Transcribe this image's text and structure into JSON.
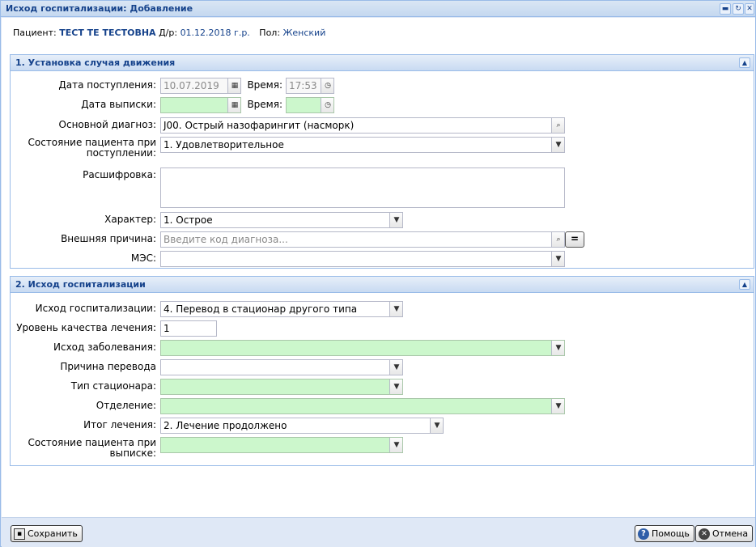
{
  "window": {
    "title": "Исход госпитализации: Добавление"
  },
  "patient": {
    "patient_label": "Пациент:",
    "name": "ТЕСТ ТЕ ТЕСТОВНА",
    "dob_label": "Д/р:",
    "dob": "01.12.2018 г.р.",
    "sex_label": "Пол:",
    "sex": "Женский"
  },
  "section1": {
    "title": "1. Установка случая движения",
    "admission_date_label": "Дата поступления:",
    "admission_date": "10.07.2019",
    "admission_time_label": "Время:",
    "admission_time": "17:53",
    "discharge_date_label": "Дата выписки:",
    "discharge_date": "",
    "discharge_time_label": "Время:",
    "discharge_time": "",
    "main_diagnosis_label": "Основной диагноз:",
    "main_diagnosis": "J00. Острый назофарингит (насморк)",
    "admission_state_label": "Состояние пациента при поступлении:",
    "admission_state": "1. Удовлетворительное",
    "decoding_label": "Расшифровка:",
    "decoding": "",
    "character_label": "Характер:",
    "character": "1. Острое",
    "external_cause_label": "Внешняя причина:",
    "external_cause_placeholder": "Введите код диагноза...",
    "eq_button": "=",
    "mes_label": "МЭС:",
    "mes": ""
  },
  "section2": {
    "title": "2. Исход госпитализации",
    "outcome_label": "Исход госпитализации:",
    "outcome": "4. Перевод в стационар другого типа",
    "quality_label": "Уровень качества лечения:",
    "quality": "1",
    "disease_outcome_label": "Исход заболевания:",
    "disease_outcome": "",
    "transfer_reason_label": "Причина перевода",
    "transfer_reason": "",
    "hospital_type_label": "Тип стационара:",
    "hospital_type": "",
    "department_label": "Отделение:",
    "department": "",
    "treatment_result_label": "Итог лечения:",
    "treatment_result": "2. Лечение продолжено",
    "discharge_state_label": "Состояние пациента при выписке:",
    "discharge_state": ""
  },
  "footer": {
    "save": "Сохранить",
    "help": "Помощь",
    "cancel": "Отмена"
  },
  "colors": {
    "required_field": "#ccf7cc",
    "title_text": "#15428b",
    "panel_bg": "#dfe8f6"
  }
}
